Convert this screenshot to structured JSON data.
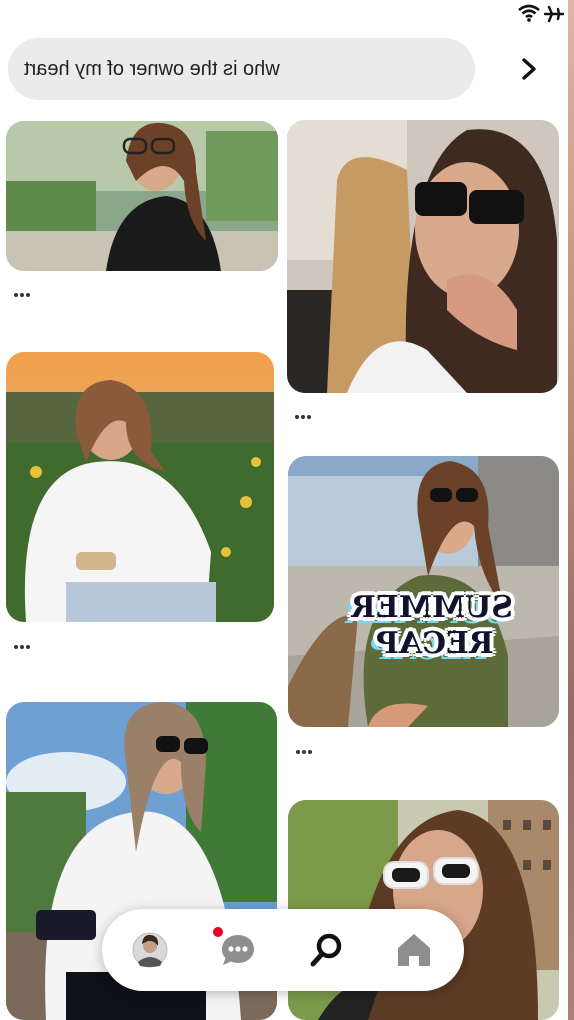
{
  "search": {
    "query": "who is the owner of my heart"
  },
  "overlay": {
    "line1": "SUMMER",
    "line2": "RECAP"
  },
  "pins": [
    {
      "name": "pin-1",
      "desc": "woman in black top with sunglasses on head"
    },
    {
      "name": "pin-2",
      "desc": "woman in car with black sunglasses"
    },
    {
      "name": "pin-3",
      "desc": "woman in white shirt at sunset"
    },
    {
      "name": "pin-4",
      "desc": "woman in olive dress by fountain"
    },
    {
      "name": "pin-5",
      "desc": "woman in white top with sunglasses"
    },
    {
      "name": "pin-6",
      "desc": "woman with white sunglasses in city"
    }
  ],
  "nav": {
    "items": [
      "profile",
      "messages",
      "search",
      "home"
    ],
    "messages_badge": true,
    "active": "search"
  },
  "colors": {
    "accent": "#e60023",
    "search_bg": "#ebebeb",
    "badge_text": "#12122e",
    "badge_shadow": "#7ad8f0"
  }
}
